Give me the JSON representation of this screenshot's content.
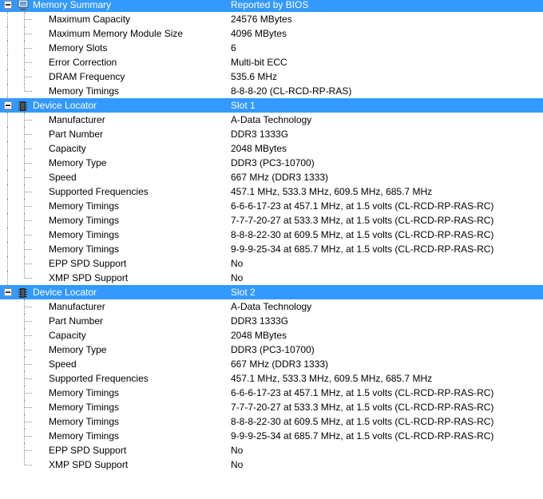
{
  "sections": [
    {
      "header": {
        "label": "Memory Summary",
        "value": "Reported by BIOS"
      },
      "icon": "computer-icon",
      "items": [
        {
          "label": "Maximum Capacity",
          "value": "24576 MBytes"
        },
        {
          "label": "Maximum Memory Module Size",
          "value": "4096 MBytes"
        },
        {
          "label": "Memory Slots",
          "value": "6"
        },
        {
          "label": "Error Correction",
          "value": "Multi-bit ECC"
        },
        {
          "label": "DRAM Frequency",
          "value": "535.6 MHz"
        },
        {
          "label": "Memory Timings",
          "value": "8-8-8-20 (CL-RCD-RP-RAS)"
        }
      ]
    },
    {
      "header": {
        "label": "Device Locator",
        "value": "Slot 1"
      },
      "icon": "memory-module-icon",
      "items": [
        {
          "label": "Manufacturer",
          "value": "A-Data Technology"
        },
        {
          "label": "Part Number",
          "value": "DDR3 1333G"
        },
        {
          "label": "Capacity",
          "value": "2048 MBytes"
        },
        {
          "label": "Memory Type",
          "value": "DDR3 (PC3-10700)"
        },
        {
          "label": "Speed",
          "value": "667 MHz (DDR3 1333)"
        },
        {
          "label": "Supported Frequencies",
          "value": "457.1 MHz, 533.3 MHz, 609.5 MHz, 685.7 MHz"
        },
        {
          "label": "Memory Timings",
          "value": "6-6-6-17-23 at 457.1 MHz, at 1.5 volts (CL-RCD-RP-RAS-RC)"
        },
        {
          "label": "Memory Timings",
          "value": "7-7-7-20-27 at 533.3 MHz, at 1.5 volts (CL-RCD-RP-RAS-RC)"
        },
        {
          "label": "Memory Timings",
          "value": "8-8-8-22-30 at 609.5 MHz, at 1.5 volts (CL-RCD-RP-RAS-RC)"
        },
        {
          "label": "Memory Timings",
          "value": "9-9-9-25-34 at 685.7 MHz, at 1.5 volts (CL-RCD-RP-RAS-RC)"
        },
        {
          "label": "EPP SPD Support",
          "value": "No"
        },
        {
          "label": "XMP SPD Support",
          "value": "No"
        }
      ]
    },
    {
      "header": {
        "label": "Device Locator",
        "value": "Slot 2"
      },
      "icon": "memory-module-icon",
      "items": [
        {
          "label": "Manufacturer",
          "value": "A-Data Technology"
        },
        {
          "label": "Part Number",
          "value": "DDR3 1333G"
        },
        {
          "label": "Capacity",
          "value": "2048 MBytes"
        },
        {
          "label": "Memory Type",
          "value": "DDR3 (PC3-10700)"
        },
        {
          "label": "Speed",
          "value": "667 MHz (DDR3 1333)"
        },
        {
          "label": "Supported Frequencies",
          "value": "457.1 MHz, 533.3 MHz, 609.5 MHz, 685.7 MHz"
        },
        {
          "label": "Memory Timings",
          "value": "6-6-6-17-23 at 457.1 MHz, at 1.5 volts (CL-RCD-RP-RAS-RC)"
        },
        {
          "label": "Memory Timings",
          "value": "7-7-7-20-27 at 533.3 MHz, at 1.5 volts (CL-RCD-RP-RAS-RC)"
        },
        {
          "label": "Memory Timings",
          "value": "8-8-8-22-30 at 609.5 MHz, at 1.5 volts (CL-RCD-RP-RAS-RC)"
        },
        {
          "label": "Memory Timings",
          "value": "9-9-9-25-34 at 685.7 MHz, at 1.5 volts (CL-RCD-RP-RAS-RC)"
        },
        {
          "label": "EPP SPD Support",
          "value": "No"
        },
        {
          "label": "XMP SPD Support",
          "value": "No"
        }
      ]
    }
  ],
  "colors": {
    "selection": "#3399ff",
    "tree_lines": "#8a8a8a"
  }
}
